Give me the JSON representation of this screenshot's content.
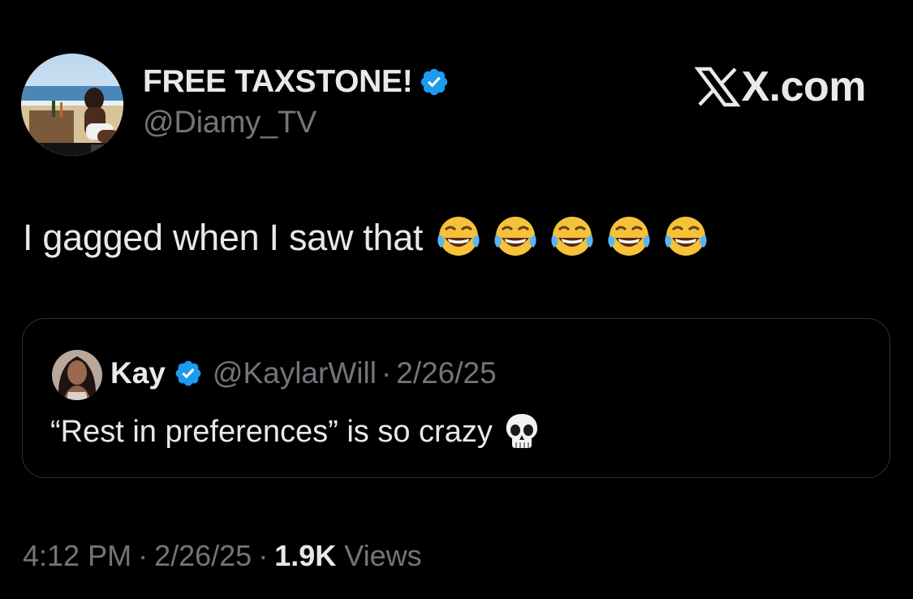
{
  "author": {
    "display_name": "FREE TAXSTONE!",
    "handle": "@Diamy_TV",
    "verified": true,
    "avatar_icon": "beach-photo-avatar"
  },
  "brand": {
    "text": "X.com",
    "icon": "x-logo-icon"
  },
  "tweet": {
    "text": "I gagged when I saw that",
    "emojis": [
      "face-with-tears-of-joy",
      "face-with-tears-of-joy",
      "face-with-tears-of-joy",
      "face-with-tears-of-joy",
      "face-with-tears-of-joy"
    ]
  },
  "quoted_tweet": {
    "display_name": "Kay",
    "handle": "@KaylarWill",
    "separator": "·",
    "date": "2/26/25",
    "verified": true,
    "text": "“Rest in preferences” is so crazy",
    "emoji": "skull"
  },
  "meta": {
    "time": "4:12 PM",
    "separator": "·",
    "date": "2/26/25",
    "views_count": "1.9K",
    "views_label": "Views"
  },
  "colors": {
    "background": "#000000",
    "primary_text": "#e7e9ea",
    "secondary_text": "#71767b",
    "verified_blue": "#1d9bf0",
    "border": "#2f3336"
  }
}
